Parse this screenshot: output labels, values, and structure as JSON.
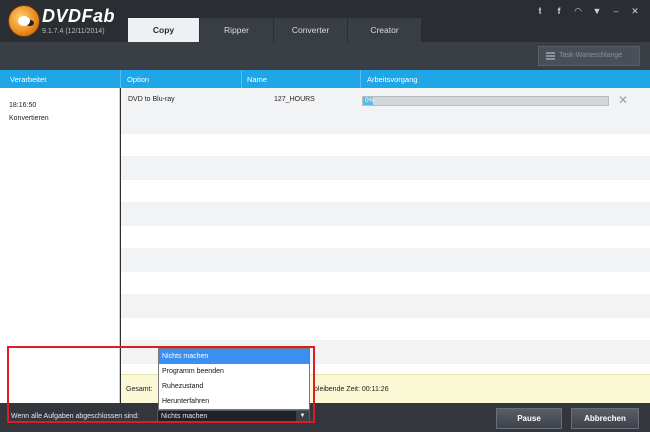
{
  "app": {
    "brand": "DVDFab",
    "version": "9.1.7.4 (12/11/2014)"
  },
  "tabs": [
    {
      "label": "Copy",
      "active": true
    },
    {
      "label": "Ripper",
      "active": false
    },
    {
      "label": "Converter",
      "active": false
    },
    {
      "label": "Creator",
      "active": false
    }
  ],
  "window_icons": [
    "twitter-icon",
    "facebook-icon",
    "wifi-icon",
    "dropdown-icon",
    "minimize-icon",
    "close-icon"
  ],
  "toolbar": {
    "queue_button": "Task-Warteschlange"
  },
  "columns": {
    "processed": "Verarbeitet",
    "option": "Option",
    "name": "Name",
    "progress": "Arbeitsvorgang"
  },
  "left_panel": {
    "time": "18:16:50",
    "status": "Konvertieren"
  },
  "tasks": [
    {
      "option": "DVD to Blu-ray",
      "name": "127_HOURS",
      "progress_percent": 0,
      "progress_label": "0%"
    }
  ],
  "summary": {
    "total_label": "Gesamt:",
    "remaining_label": "bleibende Zeit: 00:11:26"
  },
  "bottom": {
    "when_done_label": "Wenn alle Aufgaben abgeschlossen sind:",
    "selected_value": "Nichts machen",
    "pause": "Pause",
    "abort": "Abbrechen"
  },
  "dropdown_options": [
    {
      "label": "Nichts machen",
      "selected": true
    },
    {
      "label": "Programm beenden",
      "selected": false
    },
    {
      "label": "Ruhezustand",
      "selected": false
    },
    {
      "label": "Herunterfahren",
      "selected": false
    }
  ],
  "colors": {
    "accent": "#1ea6e6",
    "highlight": "#e01b24",
    "summary_bg": "#fbf8d6"
  }
}
